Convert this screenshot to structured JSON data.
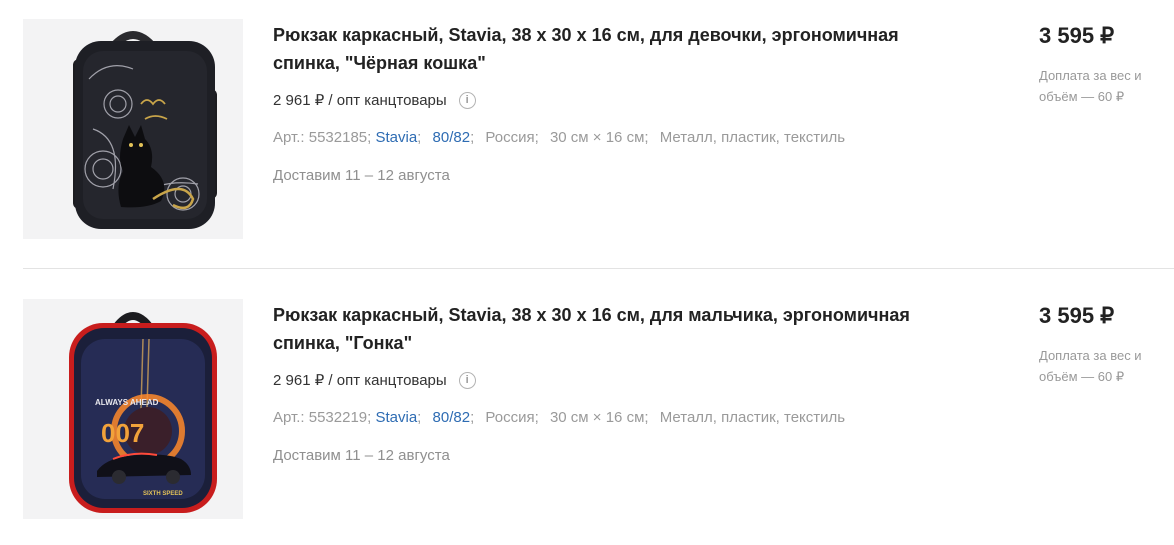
{
  "colors": {
    "link": "#2e6cb3",
    "muted": "#9a9a9a",
    "divider": "#e3e3e3"
  },
  "products": [
    {
      "title": "Рюкзак каркасный, Stavia, 38 х 30 х 16 см, для девочки, эргономичная спинка, \"Чёрная кошка\"",
      "wholesale": "2 961 ₽ / опт канцтовары",
      "article": "Арт.: 5532185;",
      "brand": "Stavia",
      "pack": "80/82",
      "country": "Россия",
      "size": "30 см × 16 см",
      "material": "Металл, пластик, текстиль",
      "delivery": "Доставим 11 – 12 августа",
      "price": "3 595 ₽",
      "surcharge": "Доплата за вес и объём — 60 ₽",
      "image_icon": "backpack-black-cat"
    },
    {
      "title": "Рюкзак каркасный, Stavia, 38 х 30 х 16 см, для мальчика, эргономичная спинка, \"Гонка\"",
      "wholesale": "2 961 ₽ / опт канцтовары",
      "article": "Арт.: 5532219;",
      "brand": "Stavia",
      "pack": "80/82",
      "country": "Россия",
      "size": "30 см × 16 см",
      "material": "Металл, пластик, текстиль",
      "delivery": "Доставим 11 – 12 августа",
      "price": "3 595 ₽",
      "surcharge": "Доплата за вес и объём — 60 ₽",
      "image_icon": "backpack-race-car",
      "image_text": {
        "slogan": "ALWAYS AHEAD",
        "number": "007",
        "tagline": "SIXTH SPEED"
      }
    }
  ]
}
